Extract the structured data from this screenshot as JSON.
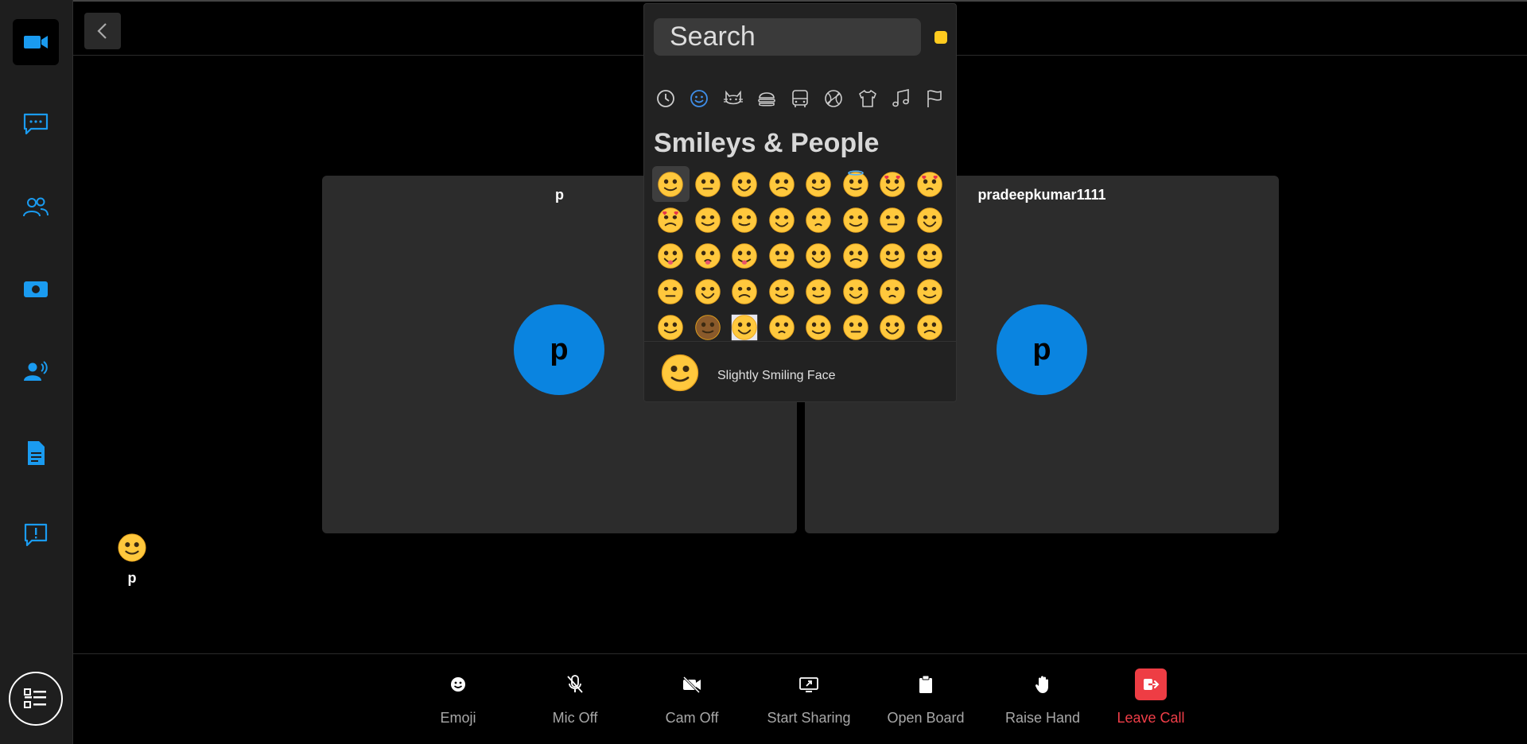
{
  "sidebar": {
    "items": [
      {
        "name": "video-icon",
        "active": true
      },
      {
        "name": "chat-icon"
      },
      {
        "name": "participants-icon"
      },
      {
        "name": "recording-icon"
      },
      {
        "name": "speaker-icon"
      },
      {
        "name": "document-icon"
      },
      {
        "name": "report-icon"
      }
    ],
    "menu_icon": "menu-list-icon"
  },
  "tiles": [
    {
      "name": "p",
      "initial": "p"
    },
    {
      "name": "pradeepkumar1111",
      "initial": "p"
    }
  ],
  "reaction": {
    "emoji": "slightly-smiling-face",
    "name": "p"
  },
  "toolbar": {
    "emoji_label": "Emoji",
    "mic_label": "Mic Off",
    "cam_label": "Cam Off",
    "share_label": "Start Sharing",
    "board_label": "Open Board",
    "hand_label": "Raise Hand",
    "leave_label": "Leave Call"
  },
  "picker": {
    "search_placeholder": "Search",
    "section_title": "Smileys & People",
    "categories": [
      "recent-icon",
      "smiley-icon",
      "animal-icon",
      "food-icon",
      "travel-icon",
      "activity-icon",
      "objects-icon",
      "symbols-icon",
      "flags-icon"
    ],
    "active_category": "smiley-icon",
    "preview_name": "Slightly Smiling Face",
    "colors": {
      "accent": "#0a84e0",
      "leave": "#ee3d44",
      "emoji": "#ffc83d",
      "skin_tone": "#ffcb1f"
    }
  }
}
